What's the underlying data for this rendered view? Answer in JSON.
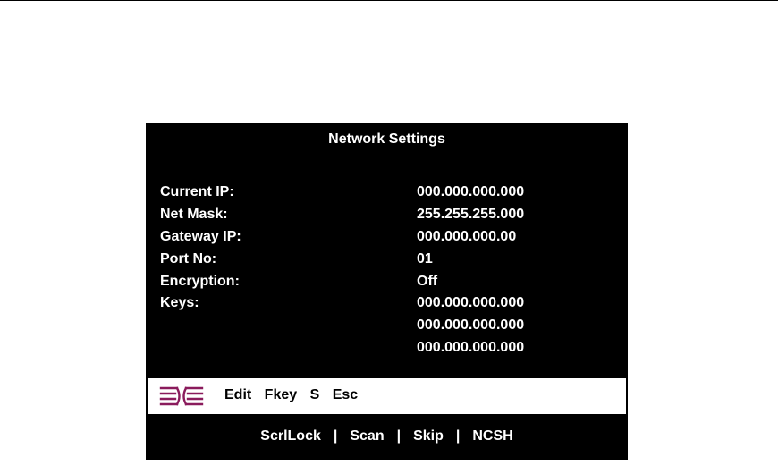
{
  "screen": {
    "title": "Network Settings",
    "fields": [
      {
        "label": "Current IP:",
        "value": "000.000.000.000"
      },
      {
        "label": "Net Mask:",
        "value": "255.255.255.000"
      },
      {
        "label": "Gateway IP:",
        "value": "000.000.000.00"
      },
      {
        "label": "Port No:",
        "value": "01"
      },
      {
        "label": "Encryption:",
        "value": "Off"
      },
      {
        "label": "Keys:",
        "values": [
          "000.000.000.000",
          "000.000.000.000",
          "000.000.000.000"
        ]
      }
    ]
  },
  "menu": {
    "icon": "avocent-logo-icon",
    "icon_color": "#8a1b5c",
    "items": [
      "Edit",
      "Fkey",
      "S",
      "Esc"
    ]
  },
  "footer": {
    "items": [
      "ScrlLock",
      "Scan",
      "Skip",
      "NCSH"
    ],
    "separator": "|"
  }
}
